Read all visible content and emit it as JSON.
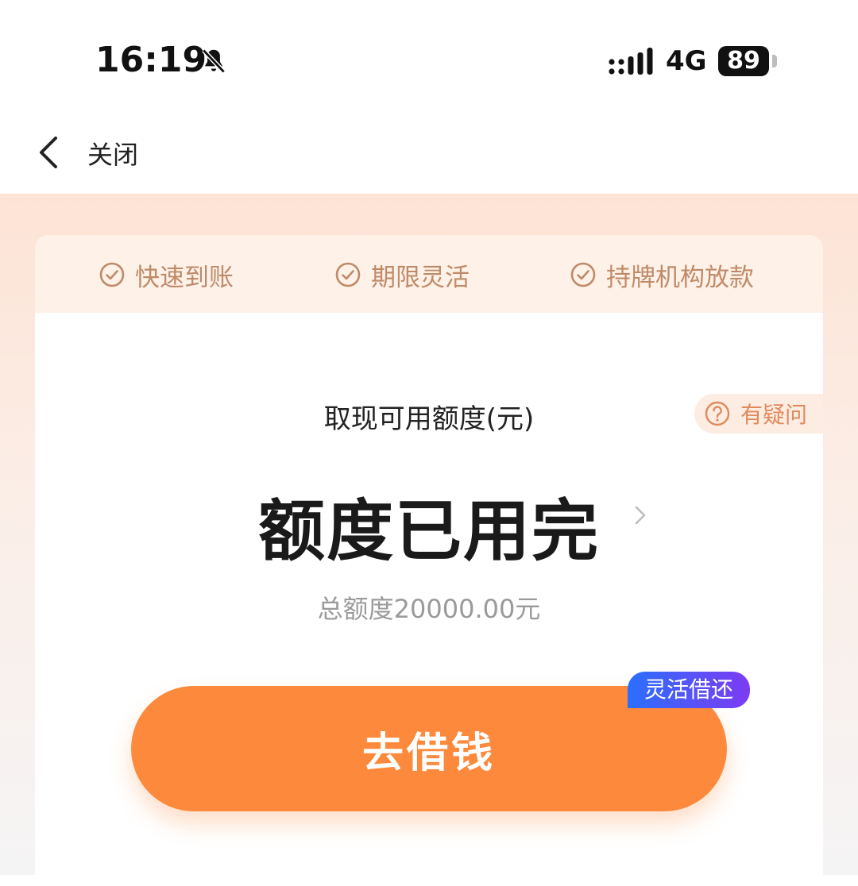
{
  "status_bar": {
    "time": "16:19",
    "network": "4G",
    "battery": "89",
    "icons": [
      "bell-slash-icon",
      "signal-icon"
    ]
  },
  "nav": {
    "back_icon": "chevron-left-icon",
    "close_label": "关闭"
  },
  "features": [
    {
      "label": "快速到账",
      "icon": "check-circle-icon"
    },
    {
      "label": "期限灵活",
      "icon": "check-circle-icon"
    },
    {
      "label": "持牌机构放款",
      "icon": "check-circle-icon"
    }
  ],
  "help": {
    "label": "有疑问",
    "icon": "question-circle-icon"
  },
  "quota": {
    "label": "取现可用额度(元)",
    "value": "额度已用完",
    "total": "总额度20000.00元"
  },
  "action": {
    "borrow_label": "去借钱",
    "badge": "灵活借还"
  },
  "colors": {
    "accent": "#fd8a3c",
    "feature_text": "#c08a68",
    "help_text": "#e08a5c",
    "badge_start": "#2a6fff",
    "badge_end": "#7d3bf2"
  }
}
